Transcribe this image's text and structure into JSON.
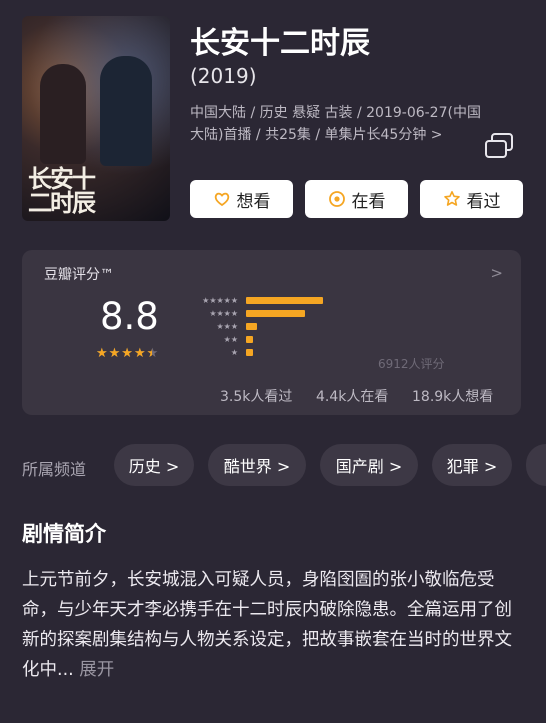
{
  "show": {
    "title": "长安十二时辰",
    "year": "(2019)",
    "meta_line1": "中国大陆 / 历史 悬疑 古装 / 2019-06-27(中国",
    "meta_line2": "大陆)首播 / 共25集 / 单集片长45分钟 >"
  },
  "poster": {
    "title_text": "长安十二时辰",
    "bg_color": "#3a2a2a"
  },
  "actions": {
    "want_label": "想看",
    "watching_label": "在看",
    "watched_label": "看过"
  },
  "rating": {
    "label": "豆瓣评分™",
    "chevron": ">",
    "score": "8.8",
    "stars_text": "★★★★★",
    "star_fraction": 0.88,
    "count": "6912人评分",
    "distribution": [
      {
        "stars": "★★★★★",
        "percent": 43
      },
      {
        "stars": "★★★★",
        "percent": 33
      },
      {
        "stars": "★★★",
        "percent": 6
      },
      {
        "stars": "★★",
        "percent": 4
      },
      {
        "stars": "★",
        "percent": 4
      }
    ],
    "stats": {
      "watched": "3.5k人看过",
      "watching": "4.4k人在看",
      "want": "18.9k人想看"
    }
  },
  "channels": {
    "label": "所属频道",
    "items": [
      "历史 >",
      "酷世界 >",
      "国产剧 >",
      "犯罪 >"
    ]
  },
  "synopsis": {
    "title": "剧情简介",
    "text": "上元节前夕，长安城混入可疑人员，身陷囹圄的张小敬临危受命，与少年天才李必携手在十二时辰内破除隐患。全篇运用了创新的探案剧集结构与人物关系设定，把故事嵌套在当时的世界文化中...",
    "expand_label": "展开"
  },
  "colors": {
    "accent": "#f5a623",
    "background": "#2b2734",
    "card": "#3a3541"
  }
}
